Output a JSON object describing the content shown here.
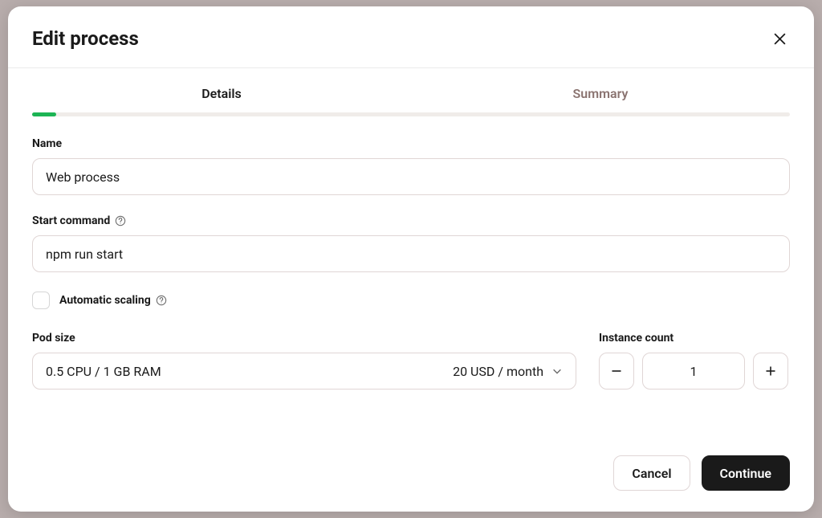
{
  "modal": {
    "title": "Edit process",
    "tabs": {
      "details": "Details",
      "summary": "Summary"
    }
  },
  "fields": {
    "name": {
      "label": "Name",
      "value": "Web process"
    },
    "start_command": {
      "label": "Start command",
      "value": "npm run start"
    },
    "automatic_scaling": {
      "label": "Automatic scaling",
      "checked": false
    },
    "pod_size": {
      "label": "Pod size",
      "spec": "0.5 CPU / 1 GB RAM",
      "price": "20 USD / month"
    },
    "instance_count": {
      "label": "Instance count",
      "value": "1"
    }
  },
  "footer": {
    "cancel": "Cancel",
    "continue": "Continue"
  }
}
